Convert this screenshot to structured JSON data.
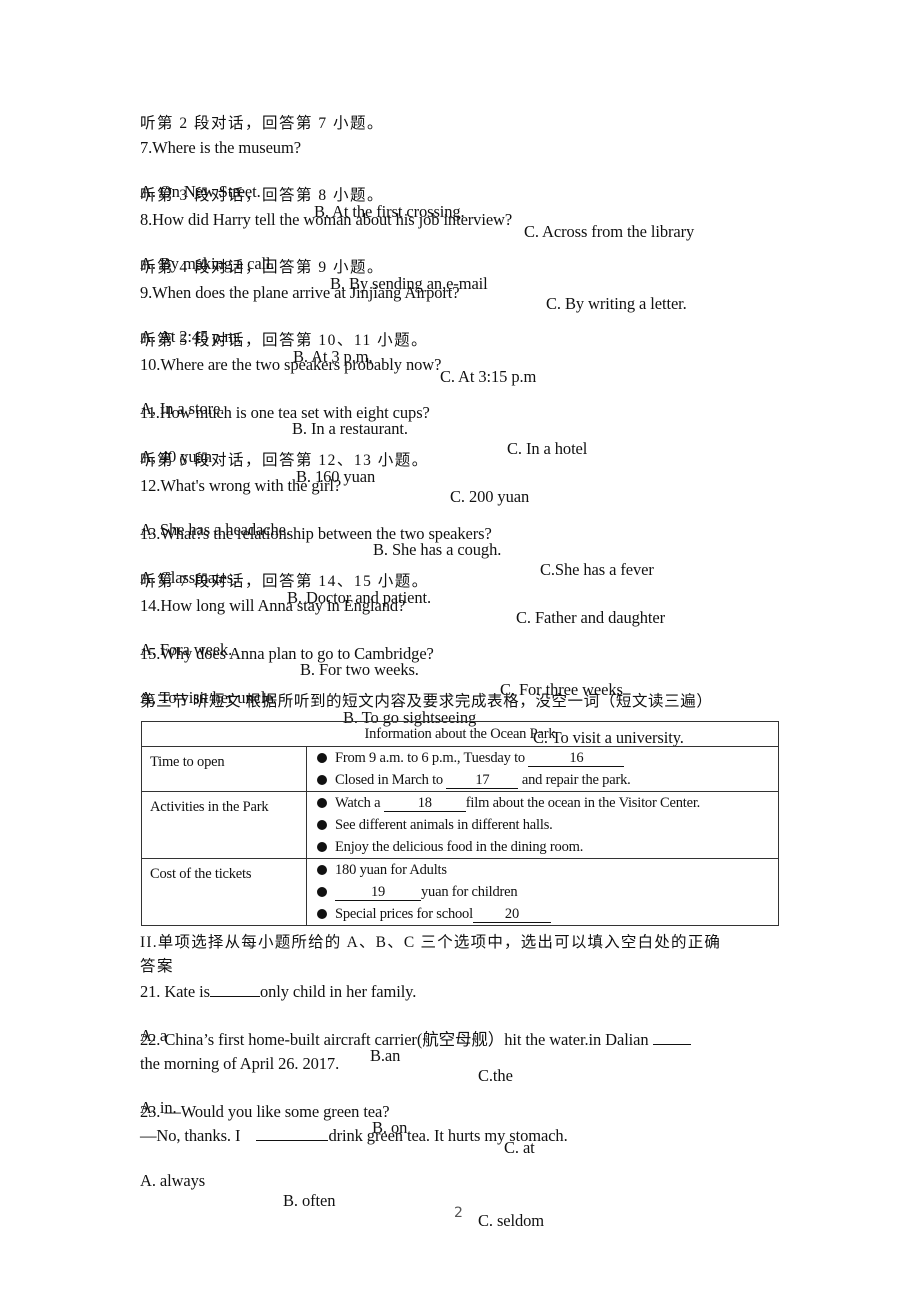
{
  "sections": {
    "s2": "听第 2 段对话，回答第 7 小题。",
    "s3": "听第 3 段对话，回答第 8 小题。",
    "s4": "听第 4 段对话，回答第 9 小题。",
    "s5": "听第 5 段对话，回答第 10、11 小题。",
    "s6": "听第 6 段对话，回答第 12、13 小题。",
    "s7": "听第 7 段对话，回答第 14、15 小题。",
    "part3": "第三节 听短文 根据所听到的短文内容及要求完成表格，没空一词（短文读三遍）",
    "part2_line1": "II.单项选择从每小题所给的 A、B、C 三个选项中，选出可以填入空白处的正确",
    "part2_line2": "答案"
  },
  "questions": [
    {
      "id": "q7",
      "text": "7.Where is the museum?",
      "options": [
        "A. On New Street.",
        "B. At the first crossing.",
        "C. Across from the library"
      ]
    },
    {
      "id": "q8",
      "text": "8.How did Harry tell the woman about his job interview?",
      "options": [
        "A. By making a call.",
        "B. By sending an,e-mail",
        "C. By writing a letter."
      ]
    },
    {
      "id": "q9",
      "text": "9.When does the plane arrive at Jinjiang Airport?",
      "options": [
        "A. At 2:45 p.m,",
        "B. At 3 p.m,",
        "C. At 3:15 p.m"
      ]
    },
    {
      "id": "q10",
      "text": "10.Where are the two speakers probably now?",
      "options": [
        "A, In a store.",
        "B. In a restaurant.",
        "C. In a hotel"
      ]
    },
    {
      "id": "q11",
      "text": "11.How much is one tea set with eight cups?",
      "options": [
        "A, 40 yuan",
        "B. 160 yuan",
        "C. 200 yuan"
      ]
    },
    {
      "id": "q12",
      "text": "12.What's wrong with the girl?",
      "options": [
        "A. She has a headache.",
        "B. She has a cough.",
        "C.She has a fever"
      ]
    },
    {
      "id": "q13",
      "text": "13.What?s the relationship between the two speakers?",
      "options": [
        "A. Classmates,",
        "B. Doctor and patient.",
        "C. Father and daughter"
      ]
    },
    {
      "id": "q14",
      "text": "14.How long will Anna stay in England?",
      "options": [
        "A. Fora week.",
        "B. For two weeks.",
        "C. For three weeks"
      ]
    },
    {
      "id": "q15",
      "text": "15.Why does Anna plan to go to Cambridge?",
      "options": [
        "A, To visit her uncle.",
        "B. To go sightseeing",
        "C. To visit a university."
      ]
    },
    {
      "id": "q21",
      "text_before": "21. Kate is",
      "blank": "",
      "text_after": "only child in her family.",
      "options": [
        "A. a",
        "B.an",
        "C.the"
      ]
    },
    {
      "id": "q22",
      "text_line1": "22. China’s first home-built aircraft carrier(航空母舰）hit the water.in Dalian",
      "text_line2": "the morning of April 26. 2017.",
      "options": [
        "A. in.",
        "B. on",
        "C. at"
      ]
    },
    {
      "id": "q23",
      "text_line1": "23. —Would you like some green tea?",
      "text_before": "—No, thanks. I",
      "text_after": "drink green tea. It hurts my stomach.",
      "options": [
        "A. always",
        "B. often",
        "C. seldom"
      ]
    }
  ],
  "table": {
    "title": "Information about the Ocean Park",
    "rows": [
      {
        "label": "Time to open",
        "items": [
          {
            "before": "From 9 a.m. to 6 p.m., Tuesday to",
            "blank": "16",
            "after": ""
          },
          {
            "before": "Closed in March to",
            "blank": "17",
            "after": "and repair the park."
          }
        ]
      },
      {
        "label": "Activities in the Park",
        "items": [
          {
            "before": "Watch a",
            "blank": "18",
            "after": "film about the ocean in the Visitor Center."
          },
          {
            "before": "See different animals in different halls.",
            "blank": "",
            "after": ""
          },
          {
            "before": "Enjoy the delicious food in the dining room.",
            "blank": "",
            "after": ""
          }
        ]
      },
      {
        "label": "Cost of the tickets",
        "items": [
          {
            "before": "180 yuan for Adults",
            "blank": "",
            "after": ""
          },
          {
            "before": "",
            "blank": "19",
            "after": "yuan for children"
          },
          {
            "before": "Special prices for school",
            "blank": "20",
            "after": ""
          }
        ]
      }
    ]
  },
  "footer": {
    "page_number": "2"
  }
}
